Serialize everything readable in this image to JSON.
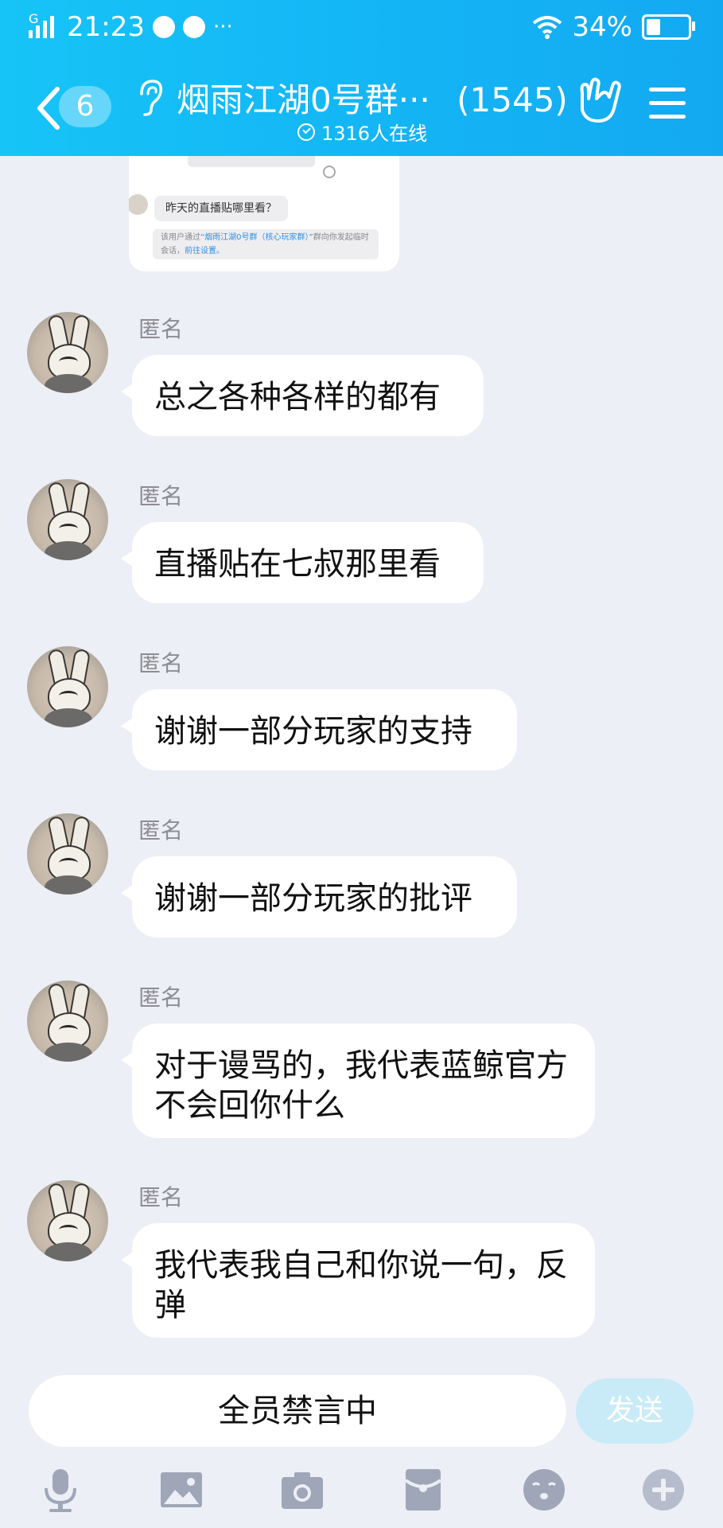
{
  "status_bar": {
    "network": "G",
    "time": "21:23",
    "more": "···",
    "battery": "34%",
    "battery_level": 0.34
  },
  "nav": {
    "unread_count": "6",
    "group_name": "烟雨江湖0号群···",
    "member_count": "(1545)",
    "online": "1316人在线"
  },
  "shared_card": {
    "question": "昨天的直播贴哪里看？",
    "note_prefix": "该用户通过",
    "note_group": "“烟雨江湖0号群（核心玩家群）”",
    "note_suffix": "群向你发起临时会话，",
    "note_link": "前往设置。"
  },
  "messages": [
    {
      "sender": "匿名",
      "text": "总之各种各样的都有"
    },
    {
      "sender": "匿名",
      "text": "直播贴在七叔那里看"
    },
    {
      "sender": "匿名",
      "text": "谢谢一部分玩家的支持"
    },
    {
      "sender": "匿名",
      "text": "谢谢一部分玩家的批评"
    },
    {
      "sender": "匿名",
      "text": "对于谩骂的，我代表蓝鲸官方不会回你什么"
    },
    {
      "sender": "匿名",
      "text": "我代表我自己和你说一句，反弹"
    }
  ],
  "input": {
    "muted_text": "全员禁言中",
    "send_label": "发送"
  },
  "toolbar": [
    "mic-icon",
    "image-icon",
    "camera-icon",
    "red-packet-icon",
    "emoji-icon",
    "plus-icon"
  ],
  "colors": {
    "header": "#14b6f5",
    "background": "#eceff5",
    "bubble": "#ffffff",
    "send_disabled": "#c9ebf7"
  }
}
